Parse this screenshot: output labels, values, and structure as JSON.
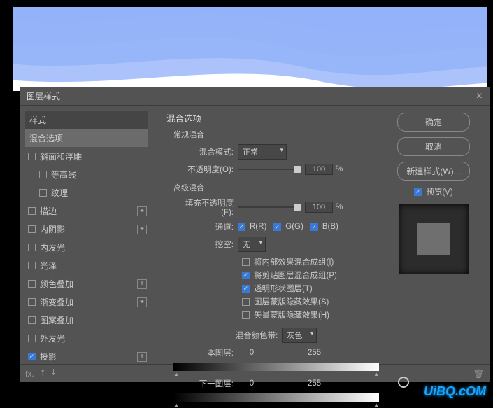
{
  "dialog": {
    "title": "图层样式"
  },
  "left": {
    "styles_hdr": "样式",
    "blend_sel": "混合选项",
    "items": [
      {
        "label": "斜面和浮雕",
        "checked": false,
        "plus": false,
        "sub": false
      },
      {
        "label": "等高线",
        "checked": false,
        "plus": false,
        "sub": true
      },
      {
        "label": "纹理",
        "checked": false,
        "plus": false,
        "sub": true
      },
      {
        "label": "描边",
        "checked": false,
        "plus": true,
        "sub": false
      },
      {
        "label": "内阴影",
        "checked": false,
        "plus": true,
        "sub": false
      },
      {
        "label": "内发光",
        "checked": false,
        "plus": false,
        "sub": false
      },
      {
        "label": "光泽",
        "checked": false,
        "plus": false,
        "sub": false
      },
      {
        "label": "颜色叠加",
        "checked": false,
        "plus": true,
        "sub": false
      },
      {
        "label": "渐变叠加",
        "checked": false,
        "plus": true,
        "sub": false
      },
      {
        "label": "图案叠加",
        "checked": false,
        "plus": false,
        "sub": false
      },
      {
        "label": "外发光",
        "checked": false,
        "plus": false,
        "sub": false
      },
      {
        "label": "投影",
        "checked": true,
        "plus": true,
        "sub": false
      }
    ]
  },
  "mid": {
    "title": "混合选项",
    "normal_title": "常规混合",
    "mode_label": "混合模式:",
    "mode_value": "正常",
    "opacity_label": "不透明度(O):",
    "opacity_value": "100",
    "opacity_unit": "%",
    "adv_title": "高级混合",
    "fill_label": "填充不透明度(F):",
    "fill_value": "100",
    "fill_unit": "%",
    "chan_label": "通道:",
    "chan_r": "R(R)",
    "chan_g": "G(G)",
    "chan_b": "B(B)",
    "knockout_label": "挖空:",
    "knockout_value": "无",
    "opts": [
      {
        "label": "将内部效果混合成组(I)",
        "checked": false
      },
      {
        "label": "将剪贴图层混合成组(P)",
        "checked": true
      },
      {
        "label": "透明形状图层(T)",
        "checked": true
      },
      {
        "label": "图层蒙版隐藏效果(S)",
        "checked": false
      },
      {
        "label": "矢量蒙版隐藏效果(H)",
        "checked": false
      }
    ],
    "blendif_label": "混合颜色带:",
    "blendif_value": "灰色",
    "this_label": "本图层:",
    "this_lo": "0",
    "this_hi": "255",
    "under_label": "下一图层:",
    "under_lo": "0",
    "under_hi": "255"
  },
  "right": {
    "ok": "确定",
    "cancel": "取消",
    "newstyle": "新建样式(W)...",
    "preview": "预览(V)"
  },
  "watermark": "UiBQ.cOM"
}
